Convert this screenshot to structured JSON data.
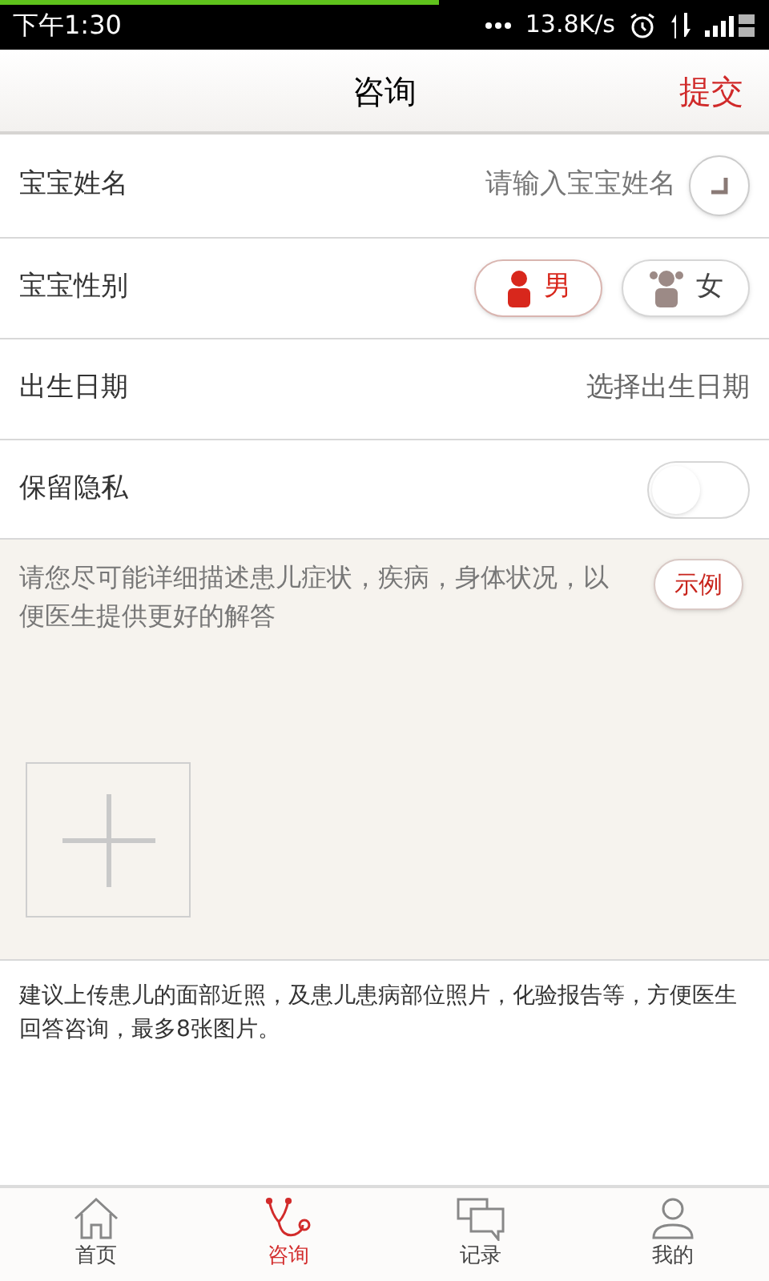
{
  "status_bar": {
    "time": "下午1:30",
    "net_speed": "13.8K/s",
    "loading": {
      "level": 0.57
    }
  },
  "header": {
    "title": "咨询",
    "action": "提交"
  },
  "form": {
    "name": {
      "label": "宝宝姓名",
      "placeholder": "请输入宝宝姓名"
    },
    "gender": {
      "label": "宝宝性别",
      "options": [
        {
          "kind": "boy",
          "label": "男",
          "selected": true
        },
        {
          "kind": "girl",
          "label": "女",
          "selected": false
        }
      ]
    },
    "birth": {
      "label": "出生日期",
      "placeholder": "选择出生日期"
    },
    "privacy": {
      "label": "保留隐私",
      "on": false
    }
  },
  "description": {
    "placeholder": "请您尽可能详细描述患儿症状，疾病，身体状况，以便医生提供更好的解答",
    "example_button": "示例"
  },
  "hint": "建议上传患儿的面部近照，及患儿患病部位照片，化验报告等，方便医生回答咨询，最多8张图片。",
  "tabs": [
    {
      "kind": "home",
      "label": "首页",
      "selected": false
    },
    {
      "kind": "consult",
      "label": "咨询",
      "selected": true
    },
    {
      "kind": "records",
      "label": "记录",
      "selected": false
    },
    {
      "kind": "me",
      "label": "我的",
      "selected": false
    }
  ]
}
